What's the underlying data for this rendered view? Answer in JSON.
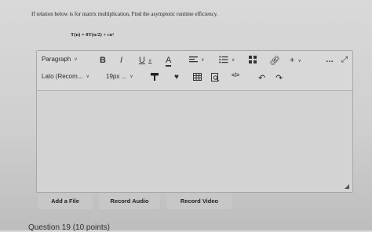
{
  "question": {
    "text": "If relation below is for matrix multiplication, Find the asymptotic runtime efficiency.",
    "formula": "T(n) = 8T(n/2) + cn²"
  },
  "editor": {
    "toolbar": {
      "paragraph_label": "Paragraph",
      "font_label": "Lato (Recom...",
      "size_label": "19px ..."
    },
    "body_text": ""
  },
  "buttons": {
    "add_file": "Add a File",
    "record_audio": "Record Audio",
    "record_video": "Record Video"
  },
  "next_question": "Question 19 (10 points)"
}
